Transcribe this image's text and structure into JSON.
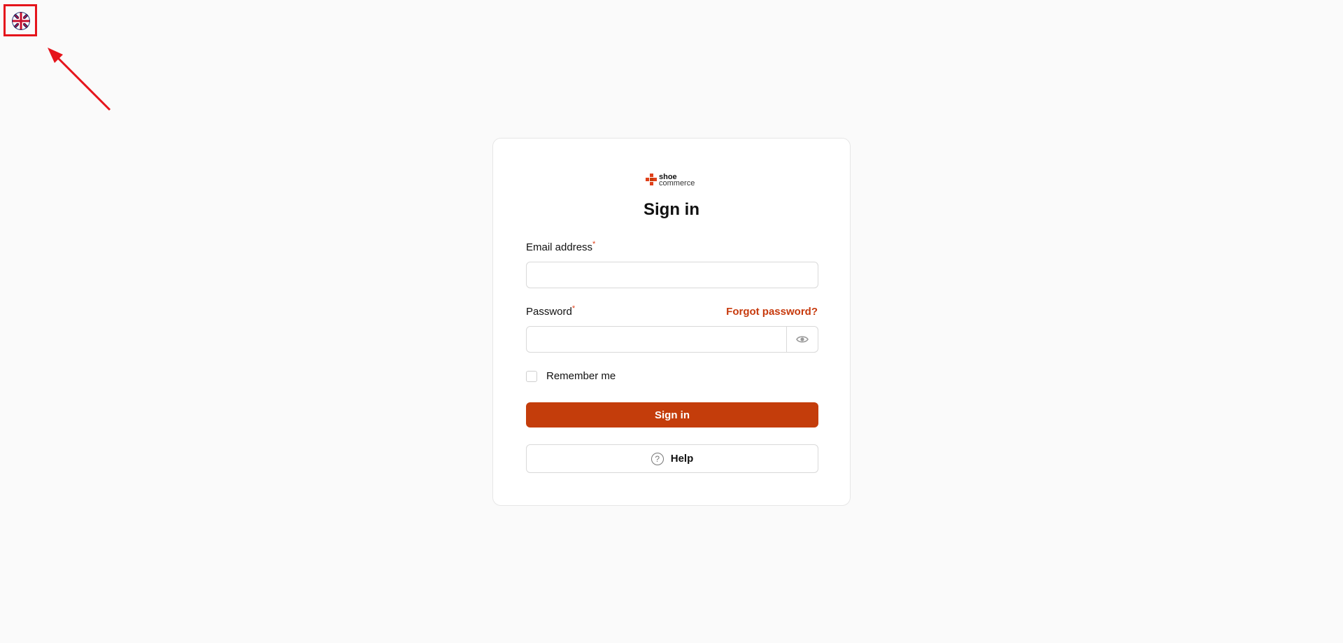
{
  "header": {
    "language_icon": "uk-flag-icon"
  },
  "logo": {
    "line1": "shoe",
    "line2": "commerce",
    "colors": [
      "#e0401a",
      "#c43d0b"
    ]
  },
  "form": {
    "title": "Sign in",
    "email_label": "Email address",
    "required_mark": "*",
    "email_value": "",
    "password_label": "Password",
    "forgot_link": "Forgot password?",
    "password_value": "",
    "remember_label": "Remember me",
    "remember_checked": false,
    "signin_button": "Sign in",
    "help_button": "Help",
    "help_icon_glyph": "?"
  },
  "colors": {
    "accent": "#c43d0b",
    "link": "#c73a0d",
    "required": "#e0401a",
    "annotation": "#e5141b"
  }
}
